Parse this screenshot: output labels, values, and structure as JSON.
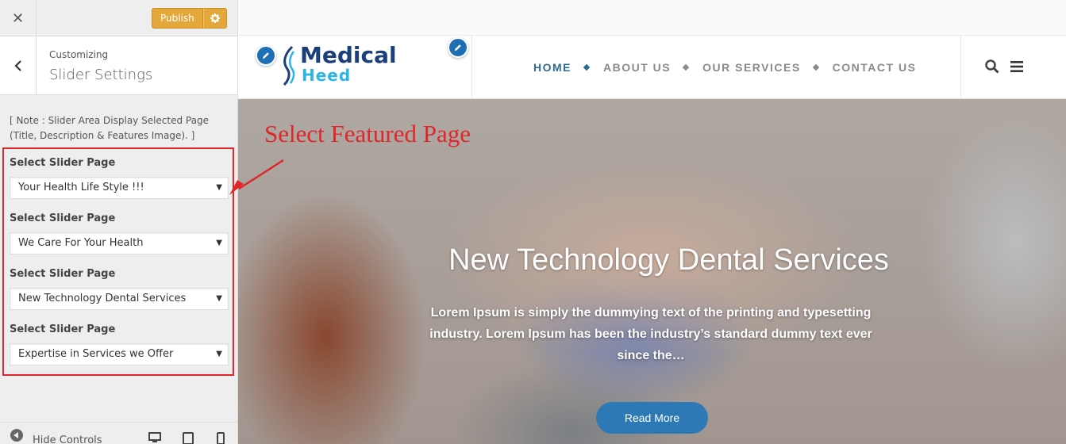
{
  "sidebar": {
    "publish_label": "Publish",
    "customizing_label": "Customizing",
    "section_title": "Slider Settings",
    "note": "[ Note : Slider Area Display Selected Page (Title, Description & Features Image). ]",
    "controls": [
      {
        "label": "Select Slider Page",
        "value": "Your Health Life Style !!!"
      },
      {
        "label": "Select Slider Page",
        "value": "We Care For Your Health"
      },
      {
        "label": "Select Slider Page",
        "value": "New Technology Dental Services"
      },
      {
        "label": "Select Slider Page",
        "value": "Expertise in Services we Offer"
      }
    ],
    "hide_controls_label": "Hide Controls"
  },
  "annotation": {
    "text": "Select Featured Page",
    "color": "#e0262b"
  },
  "site": {
    "logo_line1": "Medical",
    "logo_line2": "Heed",
    "nav": [
      "HOME",
      "ABOUT US",
      "OUR SERVICES",
      "CONTACT US"
    ],
    "active_nav": "HOME"
  },
  "hero": {
    "title": "New Technology Dental Services",
    "text": "Lorem Ipsum is simply the dummying text of the printing and typesetting industry. Lorem Ipsum has been the industry’s standard dummy text ever since the…",
    "button_label": "Read More"
  },
  "colors": {
    "publish": "#e4a83a",
    "accent_blue": "#2d79b6",
    "nav_active": "#2d6a93"
  }
}
